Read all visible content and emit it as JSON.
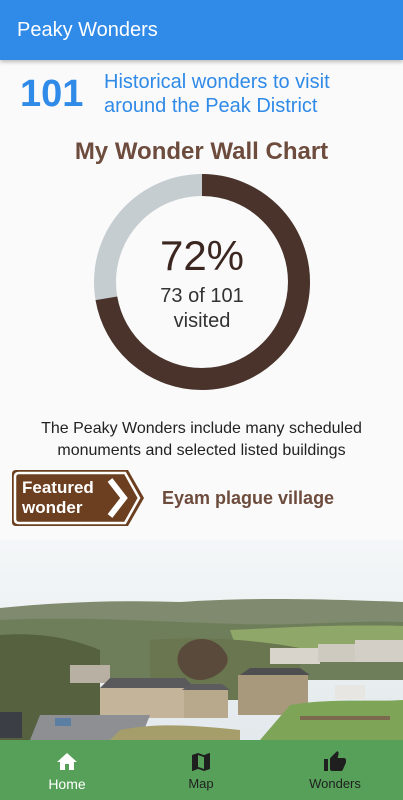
{
  "app": {
    "title": "Peaky Wonders"
  },
  "intro": {
    "count": "101",
    "description": "Historical wonders to visit around the Peak District"
  },
  "wall_chart": {
    "title": "My Wonder Wall Chart",
    "percent_label": "72%",
    "visited_label": "73 of 101 visited",
    "visited": 73,
    "total": 101,
    "colors": {
      "progress": "#4a332b",
      "remaining": "#c5cdd0"
    }
  },
  "info_text": "The Peaky Wonders include many scheduled monuments and selected listed buildings",
  "featured": {
    "sign_label": "Featured wonder",
    "name": "Eyam plague village"
  },
  "nav": {
    "items": [
      {
        "label": "Home",
        "icon": "home-icon",
        "active": true
      },
      {
        "label": "Map",
        "icon": "map-icon",
        "active": false
      },
      {
        "label": "Wonders",
        "icon": "thumbs-up-icon",
        "active": false
      }
    ]
  },
  "colors": {
    "primary": "#2f8ae8",
    "brown": "#6d4c3d",
    "nav_green": "#57a05a"
  }
}
